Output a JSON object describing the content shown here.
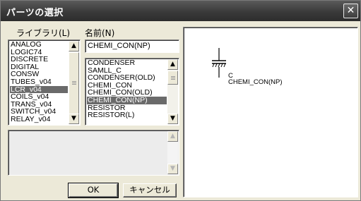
{
  "window": {
    "title": "パーツの選択",
    "close_glyph": "✕"
  },
  "library": {
    "label": "ライブラリ(L)",
    "items": [
      "ANALOG",
      "LOGIC74",
      "DISCRETE",
      "DIGITAL",
      "CONSW",
      "TUBES_v04",
      "LCR_v04",
      "COILS_v04",
      "TRANS_v04",
      "SWITCH_v04",
      "RELAY_v04"
    ],
    "selected": "LCR_v04"
  },
  "name": {
    "label": "名前(N)",
    "value": "CHEMI_CON(NP)",
    "items": [
      "CONDENSER",
      "SAMLL_C",
      "CONDENSER(OLD)",
      "CHEMI_CON",
      "CHEMI_CON(OLD)",
      "CHEMI_CON(NP)",
      "RESISTOR",
      "RESISTOR(L)"
    ],
    "selected": "CHEMI_CON(NP)"
  },
  "preview": {
    "ref": "C",
    "part": "CHEMI_CON(NP)"
  },
  "buttons": {
    "ok": "OK",
    "cancel": "キャンセル"
  },
  "icons": {
    "scroll_up": "▲",
    "scroll_down": "▼"
  }
}
